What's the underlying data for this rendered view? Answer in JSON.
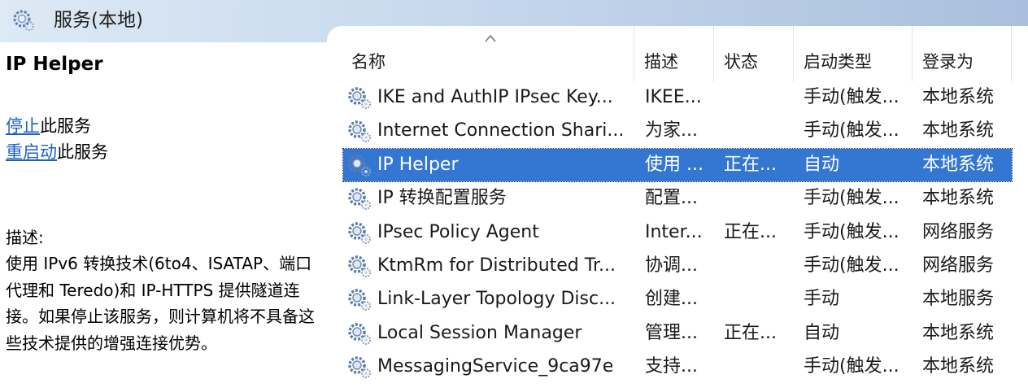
{
  "header": {
    "title": "服务(本地)",
    "icon": "services-gear-icon"
  },
  "left_pane": {
    "service_title": "IP Helper",
    "actions": [
      {
        "link": "停止",
        "rest": "此服务"
      },
      {
        "link": "重启动",
        "rest": "此服务"
      }
    ],
    "description_label": "描述:",
    "description_text": "使用 IPv6 转换技术(6to4、ISATAP、端口代理和 Teredo)和 IP-HTTPS 提供隧道连接。如果停止该服务，则计算机将不具备这些技术提供的增强连接优势。"
  },
  "table": {
    "columns": [
      "名称",
      "描述",
      "状态",
      "启动类型",
      "登录为"
    ],
    "sort_icon": "sort-up-chevron-icon",
    "selected_index": 2,
    "selected_color": "#3377d3",
    "rows": [
      {
        "name": "IKE and AuthIP IPsec Key...",
        "desc": "IKEE...",
        "status": "",
        "startup": "手动(触发...",
        "logon": "本地系统"
      },
      {
        "name": "Internet Connection Shari...",
        "desc": "为家...",
        "status": "",
        "startup": "手动(触发...",
        "logon": "本地系统"
      },
      {
        "name": "IP Helper",
        "desc": "使用 ...",
        "status": "正在...",
        "startup": "自动",
        "logon": "本地系统"
      },
      {
        "name": "IP 转换配置服务",
        "desc": "配置...",
        "status": "",
        "startup": "手动(触发...",
        "logon": "本地系统"
      },
      {
        "name": "IPsec Policy Agent",
        "desc": "Inter...",
        "status": "正在...",
        "startup": "手动(触发...",
        "logon": "网络服务"
      },
      {
        "name": "KtmRm for Distributed Tr...",
        "desc": "协调...",
        "status": "",
        "startup": "手动(触发...",
        "logon": "网络服务"
      },
      {
        "name": "Link-Layer Topology Disc...",
        "desc": "创建...",
        "status": "",
        "startup": "手动",
        "logon": "本地服务"
      },
      {
        "name": "Local Session Manager",
        "desc": "管理...",
        "status": "正在...",
        "startup": "自动",
        "logon": "本地系统"
      },
      {
        "name": "MessagingService_9ca97e",
        "desc": "支持...",
        "status": "",
        "startup": "手动(触发...",
        "logon": "本地系统"
      }
    ]
  }
}
